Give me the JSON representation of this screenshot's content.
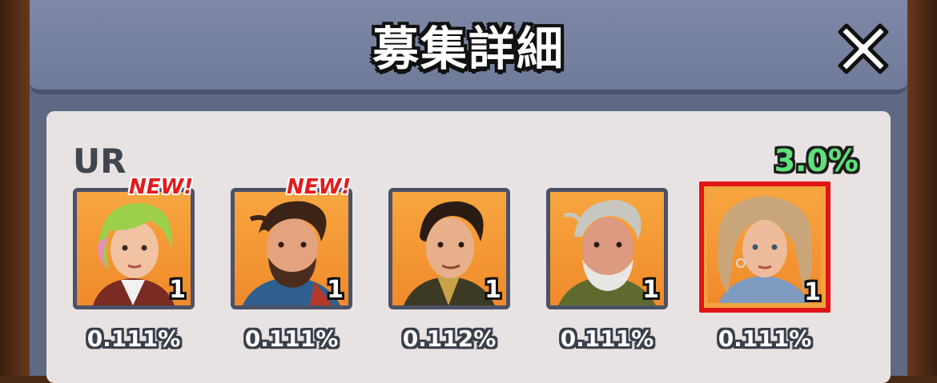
{
  "dialog": {
    "title": "募集詳細",
    "close_icon": "close-icon"
  },
  "pool": {
    "rarity": "UR",
    "rate": "3.0%",
    "heroes": [
      {
        "new_badge": "NEW!",
        "count": "1",
        "rate": "0.111%",
        "selected": false,
        "portrait": "green-haired-woman-portrait"
      },
      {
        "new_badge": "NEW!",
        "count": "1",
        "rate": "0.111%",
        "selected": false,
        "portrait": "bearded-man-portrait"
      },
      {
        "new_badge": "",
        "count": "1",
        "rate": "0.112%",
        "selected": false,
        "portrait": "dark-haired-man-portrait"
      },
      {
        "new_badge": "",
        "count": "1",
        "rate": "0.111%",
        "selected": false,
        "portrait": "gray-haired-old-man-portrait"
      },
      {
        "new_badge": "",
        "count": "1",
        "rate": "0.111%",
        "selected": true,
        "portrait": "blonde-woman-portrait"
      }
    ]
  },
  "colors": {
    "panel": "#5f6984",
    "content": "#e8e3e2",
    "new_badge": "#e61a1a",
    "rate_green": "#5fe07a",
    "selection": "#e01515"
  }
}
